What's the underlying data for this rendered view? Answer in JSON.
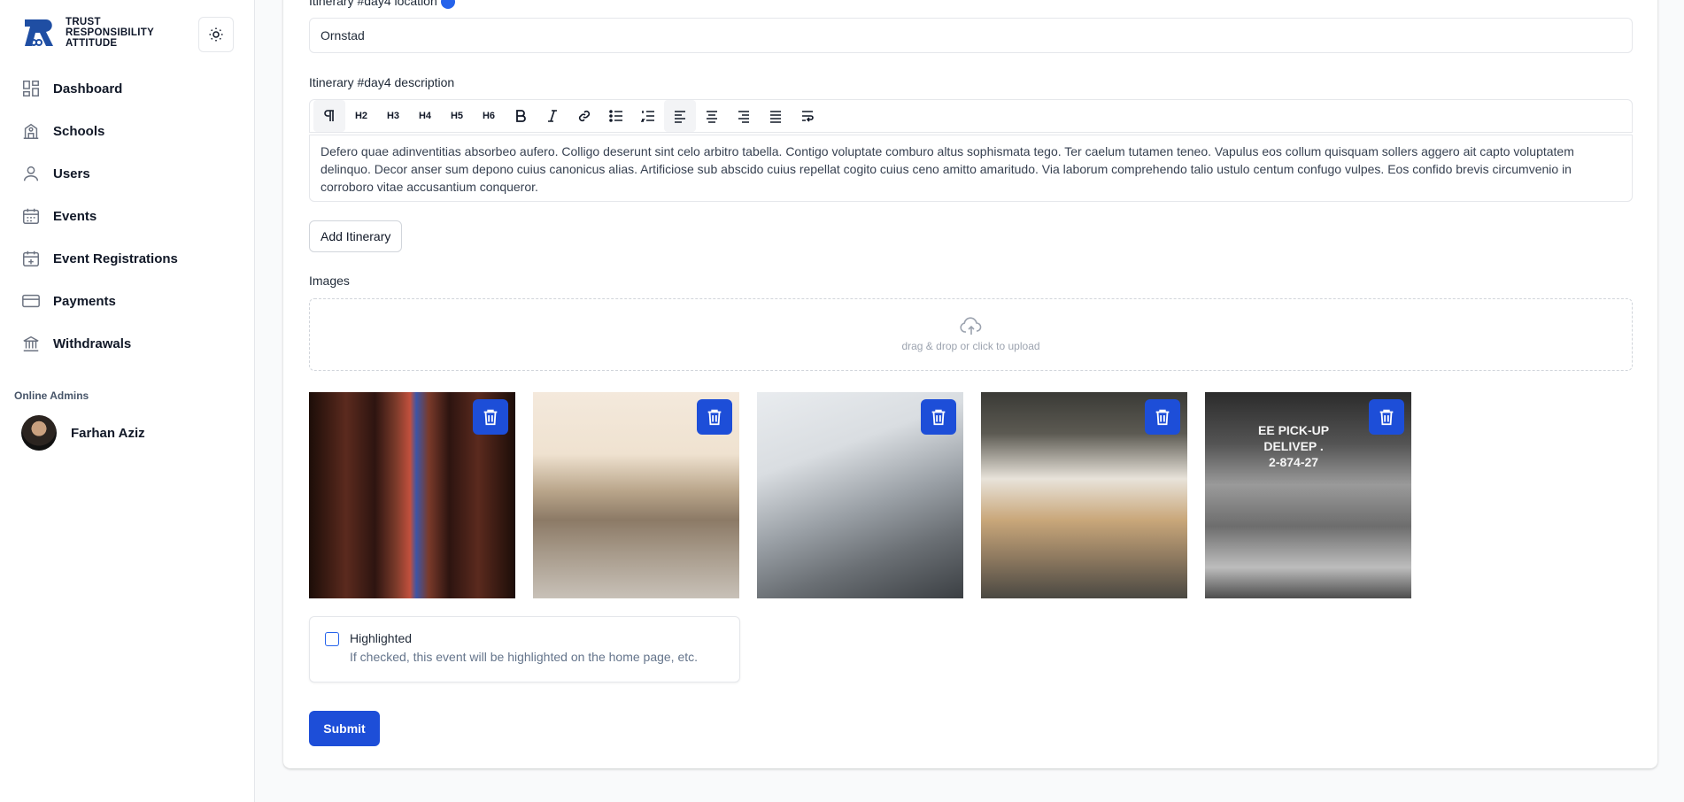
{
  "brand": {
    "line1": "TRUST",
    "line2": "RESPONSIBILITY",
    "line3": "ATTITUDE"
  },
  "sidebar": {
    "items": [
      {
        "label": "Dashboard",
        "icon": "dashboard-icon"
      },
      {
        "label": "Schools",
        "icon": "school-icon"
      },
      {
        "label": "Users",
        "icon": "user-icon"
      },
      {
        "label": "Events",
        "icon": "calendar-icon"
      },
      {
        "label": "Event Registrations",
        "icon": "calendar-plus-icon"
      },
      {
        "label": "Payments",
        "icon": "credit-card-icon"
      },
      {
        "label": "Withdrawals",
        "icon": "bank-icon"
      }
    ],
    "online_admins_label": "Online Admins",
    "admin_name": "Farhan Aziz"
  },
  "form": {
    "location_label": "Itinerary #day4 location",
    "location_value": "Ornstad",
    "description_label": "Itinerary #day4 description",
    "toolbar": [
      "H2",
      "H3",
      "H4",
      "H5",
      "H6"
    ],
    "description_value": "Defero quae adinventitias absorbeo aufero. Colligo deserunt sint celo arbitro tabella. Contigo voluptate comburo altus sophismata tego. Ter caelum tutamen teneo. Vapulus eos collum quisquam sollers aggero ait capto voluptatem delinquo. Decor anser sum depono cuius canonicus alias. Artificiose sub abscido cuius repellat cogito cuius ceno amitto amaritudo. Via laborum comprehendo talio ustulo centum confugo vulpes. Eos confido brevis circumvenio in corroboro vitae accusantium conqueror.",
    "add_itinerary_label": "Add Itinerary",
    "images_label": "Images",
    "dropzone_text": "drag & drop or click to upload",
    "image5_sign": "EE PICK-UP\nDELIVEP .\n2-874-27",
    "highlighted_label": "Highlighted",
    "highlighted_help": "If checked, this event will be highlighted on the home page, etc.",
    "highlighted_checked": false,
    "submit_label": "Submit"
  },
  "colors": {
    "primary": "#1d4ed8",
    "border": "#e5e7eb"
  }
}
